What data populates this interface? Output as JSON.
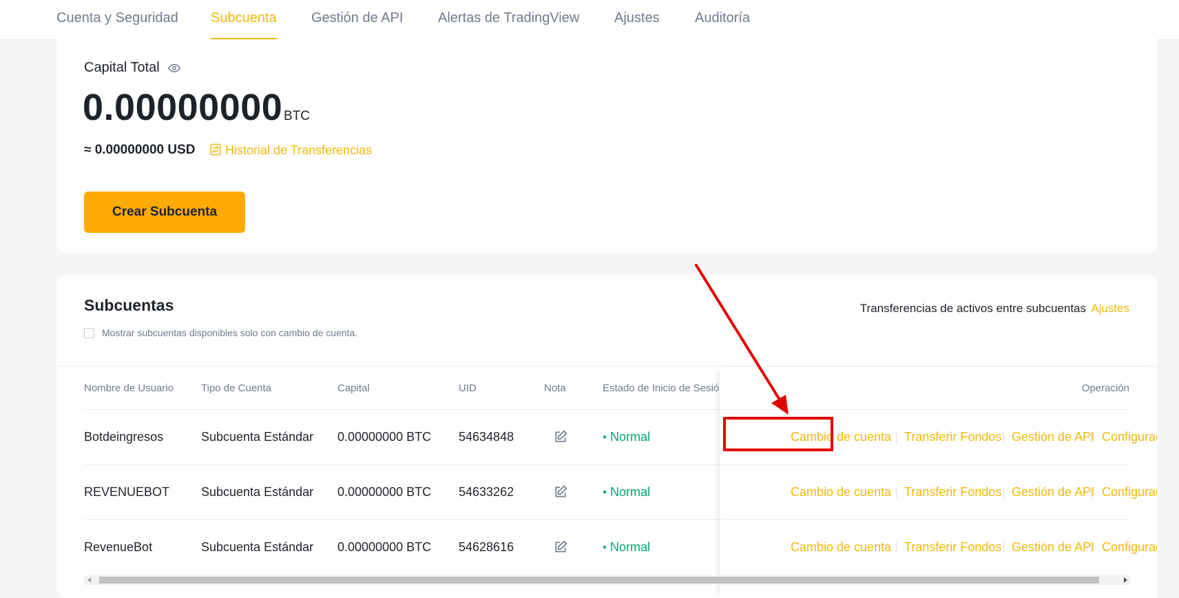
{
  "tabs": [
    {
      "label": "Cuenta y Seguridad"
    },
    {
      "label": "Subcuenta"
    },
    {
      "label": "Gestión de API"
    },
    {
      "label": "Alertas de TradingView"
    },
    {
      "label": "Ajustes"
    },
    {
      "label": "Auditoría"
    }
  ],
  "capital": {
    "label": "Capital Total",
    "value": "0.00000000",
    "unit": "BTC",
    "usd": "≈ 0.00000000 USD",
    "history_link": "Historial de Transferencias",
    "create_button": "Crear Subcuenta"
  },
  "subaccounts": {
    "title": "Subcuentas",
    "checkbox_label": "Mostrar subcuentas disponibles solo con cambio de cuenta.",
    "transfer_text": "Transferencias de activos entre subcuentas",
    "transfer_link": "Ajustes",
    "columns": {
      "username": "Nombre de Usuario",
      "type": "Tipo de Cuenta",
      "capital": "Capital",
      "uid": "UID",
      "note": "Nota",
      "status": "Estado de Inicio de Sesió",
      "operation": "Operación"
    },
    "rows": [
      {
        "username": "Botdeingresos",
        "type": "Subcuenta Estándar",
        "capital": "0.00000000 BTC",
        "uid": "54634848",
        "status": "Normal"
      },
      {
        "username": "REVENUEBOT",
        "type": "Subcuenta Estándar",
        "capital": "0.00000000 BTC",
        "uid": "54633262",
        "status": "Normal"
      },
      {
        "username": "RevenueBot",
        "type": "Subcuenta Estándar",
        "capital": "0.00000000 BTC",
        "uid": "54628616",
        "status": "Normal"
      }
    ],
    "operations": {
      "switch": "Cambio de cuenta",
      "transfer": "Transferir Fondos",
      "api": "Gestión de API",
      "config": "Configuración"
    }
  },
  "colors": {
    "accent": "#f0b90b",
    "button": "#fcaa05",
    "status_normal": "#03a66d",
    "annotation": "#e30000"
  }
}
